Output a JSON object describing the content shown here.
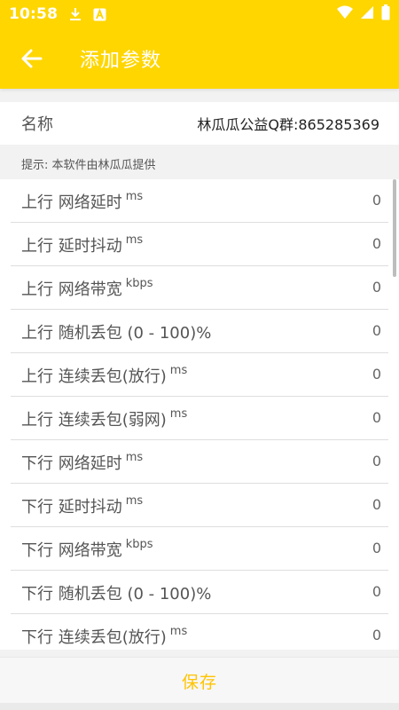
{
  "status_bar": {
    "time": "10:58",
    "icons": [
      "download-icon",
      "a-icon",
      "wifi-icon",
      "signal-icon",
      "battery-icon"
    ]
  },
  "app_bar": {
    "title": "添加参数",
    "back_icon": "arrow-left-icon"
  },
  "name_row": {
    "label": "名称",
    "value": "林瓜瓜公益Q群:865285369"
  },
  "tip": "提示: 本软件由林瓜瓜提供",
  "params": [
    {
      "label": "上行 网络延时",
      "unit": "ms",
      "value": "0"
    },
    {
      "label": "上行 延时抖动",
      "unit": "ms",
      "value": "0"
    },
    {
      "label": "上行 网络带宽",
      "unit": "kbps",
      "value": "0"
    },
    {
      "label": "上行 随机丢包 (0 - 100)%",
      "unit": "",
      "value": "0"
    },
    {
      "label": "上行 连续丢包(放行)",
      "unit": "ms",
      "value": "0"
    },
    {
      "label": "上行 连续丢包(弱网)",
      "unit": "ms",
      "value": "0"
    },
    {
      "label": "下行 网络延时",
      "unit": "ms",
      "value": "0"
    },
    {
      "label": "下行 延时抖动",
      "unit": "ms",
      "value": "0"
    },
    {
      "label": "下行 网络带宽",
      "unit": "kbps",
      "value": "0"
    },
    {
      "label": "下行 随机丢包 (0 - 100)%",
      "unit": "",
      "value": "0"
    },
    {
      "label": "下行 连续丢包(放行)",
      "unit": "ms",
      "value": "0"
    }
  ],
  "save_label": "保存",
  "colors": {
    "accent": "#FFD600",
    "save_text": "#FFC400"
  }
}
